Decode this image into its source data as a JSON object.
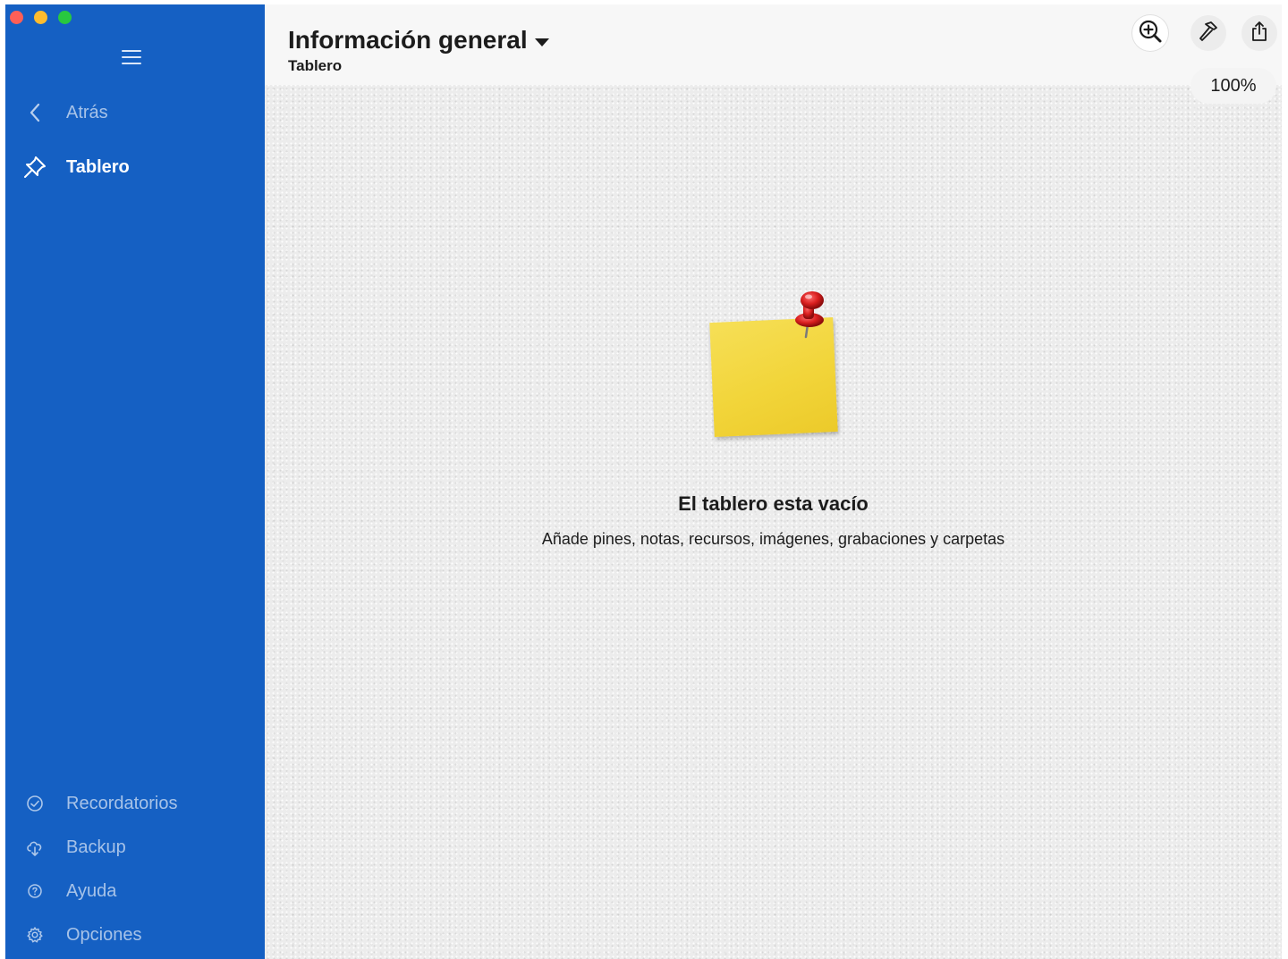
{
  "window": {
    "traffic_lights": {
      "close_color": "#fe5f57",
      "minimize_color": "#febc2e",
      "zoom_color": "#28c840"
    }
  },
  "sidebar": {
    "accent_color": "#1560c3",
    "menu_icon": "hamburger-icon",
    "back": {
      "label": "Atrás",
      "icon": "chevron-left-icon"
    },
    "items": [
      {
        "label": "Tablero",
        "icon": "pin-icon",
        "active": true
      }
    ],
    "bottom_items": [
      {
        "label": "Recordatorios",
        "icon": "check-circle-icon"
      },
      {
        "label": "Backup",
        "icon": "cloud-icon"
      },
      {
        "label": "Ayuda",
        "icon": "help-circle-icon"
      },
      {
        "label": "Opciones",
        "icon": "gear-icon"
      }
    ]
  },
  "header": {
    "title": "Información general",
    "subtitle": "Tablero",
    "toolbar": {
      "zoom_icon": "zoom-in-icon",
      "tools_icon": "hammer-icon",
      "share_icon": "share-icon",
      "zoom_level": "100%"
    }
  },
  "board": {
    "empty_title": "El tablero esta vacío",
    "empty_subtitle": "Añade pines, notas, recursos, imágenes, grabaciones y carpetas",
    "illustration": "sticky-note-with-pushpin"
  }
}
